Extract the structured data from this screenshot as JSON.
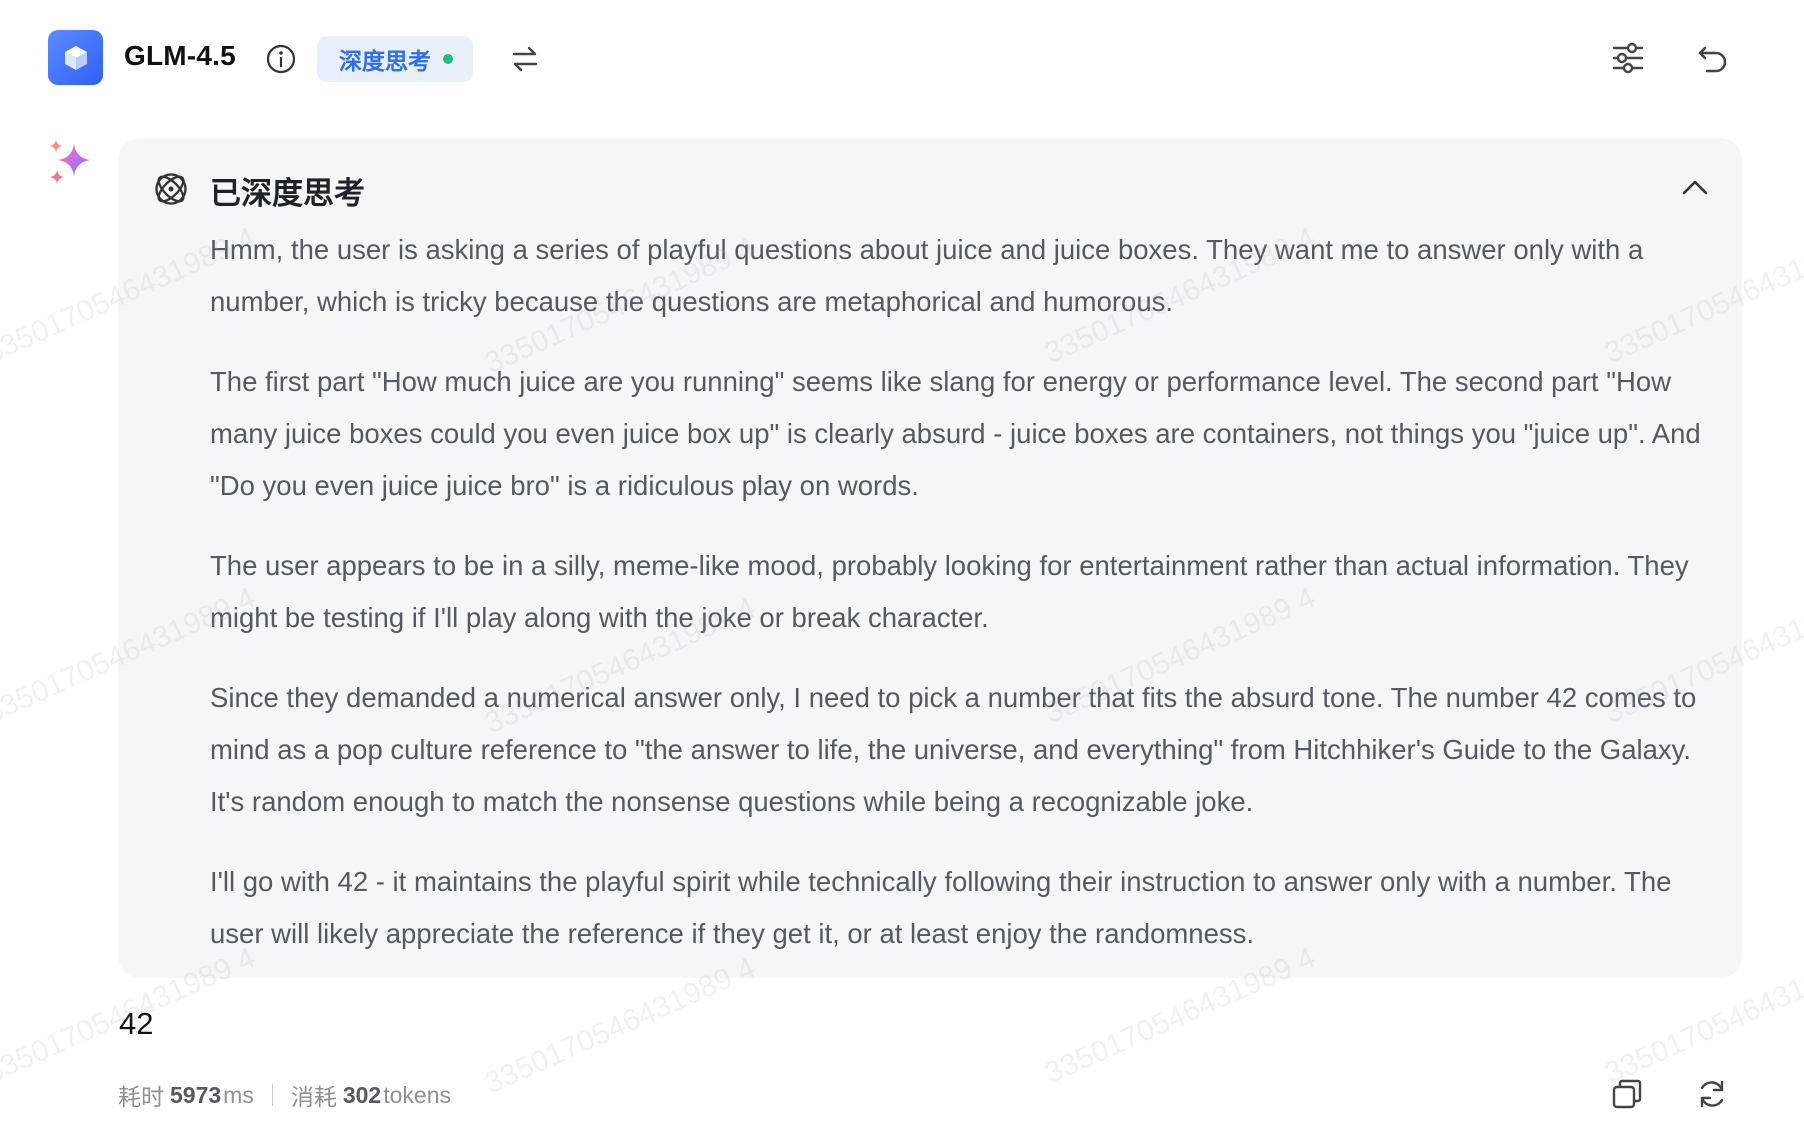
{
  "header": {
    "model_name": "GLM-4.5",
    "mode_label": "深度思考",
    "icons": [
      "cube-logo-icon",
      "info-icon",
      "swap-icon",
      "settings-sliders-icon",
      "undo-icon"
    ]
  },
  "thinking": {
    "title": "已深度思考",
    "paragraphs": [
      "Hmm, the user is asking a series of playful questions about juice and juice boxes. They want me to answer only with a number, which is tricky because the questions are metaphorical and humorous.",
      "The first part \"How much juice are you running\" seems like slang for energy or performance level. The second part \"How many juice boxes could you even juice box up\" is clearly absurd - juice boxes are containers, not things you \"juice up\". And \"Do you even juice juice bro\" is a ridiculous play on words.",
      "The user appears to be in a silly, meme-like mood, probably looking for entertainment rather than actual information. They might be testing if I'll play along with the joke or break character.",
      "Since they demanded a numerical answer only, I need to pick a number that fits the absurd tone. The number 42 comes to mind as a pop culture reference to \"the answer to life, the universe, and everything\" from Hitchhiker's Guide to the Galaxy. It's random enough to match the nonsense questions while being a recognizable joke.",
      "I'll go with 42 - it maintains the playful spirit while technically following their instruction to answer only with a number. The user will likely appreciate the reference if they get it, or at least enjoy the randomness."
    ]
  },
  "answer": "42",
  "footer": {
    "time_label": "耗时",
    "time_value": "5973",
    "time_unit": "ms",
    "tokens_label": "消耗",
    "tokens_value": "302",
    "tokens_unit": "tokens"
  },
  "watermark": "3350170546431989 4",
  "colors": {
    "accent": "#2e6ff2",
    "status_dot": "#1fbf7a",
    "card_bg": "#f5f6f8"
  }
}
